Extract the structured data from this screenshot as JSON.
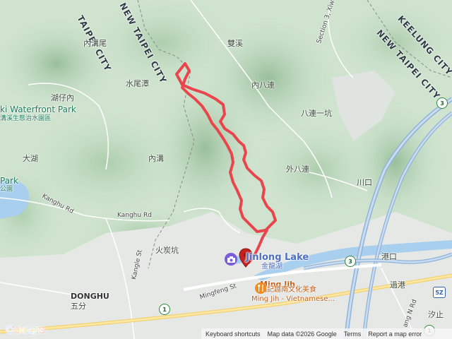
{
  "labels": {
    "taipei_city": "TAIPEI CITY",
    "new_taipei_city": "NEW TAIPEI CITY",
    "keelung_city": "KEELUNG CITY",
    "neihuwei": "內溝尾",
    "shuangxi": "雙溪",
    "shuiweitan": "水尾潭",
    "neibalian": "內八連",
    "huzainei": "湖仔內",
    "waterfront_park": "ki Waterfront Park",
    "waterfront_park_sub": "溝溪生態治水園區",
    "balianyikeng": "八連一坑",
    "dahu": "大湖",
    "neigou": "內溝",
    "waibalian": "外八連",
    "chuankou": "川口",
    "park": "Park",
    "park_sub": "公園",
    "kanghu_rd_1": "Kanghu Rd",
    "kanghu_rd_2": "Kanghu Rd",
    "kangle_st": "Kangle St",
    "huotankeng": "火炭坑",
    "gangkou": "港口",
    "lake": "Jinlong Lake",
    "lake_sub": "金龍湖",
    "mingfeng_st": "Mingfeng St",
    "restaurant": "Ming Jih",
    "restaurant_sub_zh": "銘記越南文化美食",
    "restaurant_sub_en": "Ming Jih - Vietnamese...",
    "guogang": "過港",
    "donghu": "DONGHU",
    "wufen": "五分",
    "xizhi": "汐止",
    "section3": "Section 3, Xiwa",
    "n_rd": "ang N Rd"
  },
  "shields": {
    "route_3": "3",
    "route_1_left": "1",
    "route_1_right": "1",
    "route_3_east": "3",
    "route_5z": "5Z"
  },
  "footer": {
    "logo": "Google",
    "keyboard": "Keyboard shortcuts",
    "map_data": "Map data ©2026 Google",
    "terms": "Terms",
    "report": "Report a map error"
  },
  "colors": {
    "route": "#e8464c",
    "terrain": "#cfe3cf",
    "water": "#a9cfee",
    "marker": "#c5221f",
    "lake_poi": "#7b5bd6",
    "restaurant_poi": "#f28b1e"
  },
  "icons": {
    "lake_poi": "camera-icon",
    "restaurant_poi": "fork-knife-icon",
    "start_marker": "map-pin-icon"
  }
}
